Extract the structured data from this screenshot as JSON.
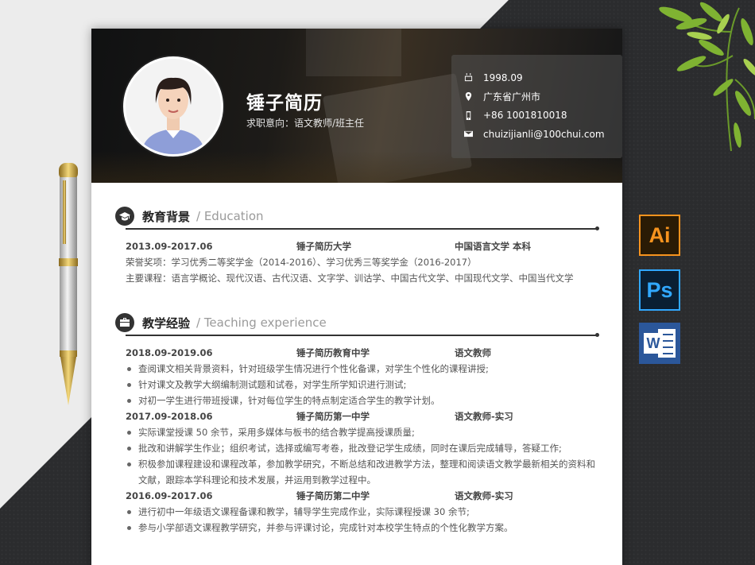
{
  "resume": {
    "name": "锤子简历",
    "objective": "求职意向：语文教师/班主任",
    "contact": {
      "birth": "1998.09",
      "location": "广东省广州市",
      "phone": "+86 1001810018",
      "email": "chuizijianli@100chui.com"
    }
  },
  "education": {
    "title": "教育背景",
    "subtitle": "/ Education",
    "period": "2013.09-2017.06",
    "school": "锤子简历大学",
    "major": "中国语言文学  本科",
    "honors": "荣誉奖项：学习优秀二等奖学金（2014-2016）、学习优秀三等奖学金（2016-2017）",
    "courses": "主要课程：语言学概论、现代汉语、古代汉语、文字学、训诂学、中国古代文学、中国现代文学、中国当代文学"
  },
  "experience": {
    "title": "教学经验",
    "subtitle": "/ Teaching experience",
    "jobs": [
      {
        "period": "2018.09-2019.06",
        "org": "锤子简历教育中学",
        "role": "语文教师",
        "items": [
          "查阅课文相关背景资料，针对班级学生情况进行个性化备课，对学生个性化的课程讲授;",
          "针对课文及教学大纲编制测试题和试卷，对学生所学知识进行测试;",
          "对初一学生进行带班授课，针对每位学生的特点制定适合学生的教学计划。"
        ]
      },
      {
        "period": "2017.09-2018.06",
        "org": "锤子简历第一中学",
        "role": "语文教师-实习",
        "items": [
          "实际课堂授课 50 余节，采用多媒体与板书的结合教学提高授课质量;",
          "批改和讲解学生作业；组织考试，选择或编写考卷，批改登记学生成绩，同时在课后完成辅导，答疑工作;",
          "积极参加课程建设和课程改革，参加教学研究，不断总结和改进教学方法，整理和阅读语文教学最新相关的资料和文献，跟踪本学科理论和技术发展，并运用到教学过程中。"
        ]
      },
      {
        "period": "2016.09-2017.06",
        "org": "锤子简历第二中学",
        "role": "语文教师-实习",
        "items": [
          "进行初中一年级语文课程备课和教学，辅导学生完成作业，实际课程授课 30 余节;",
          "参与小学部语文课程教学研究，并参与评课讨论，完成针对本校学生特点的个性化教学方案。"
        ]
      }
    ]
  },
  "side_icons": {
    "ai": "Ai",
    "ps": "Ps",
    "word": "W"
  },
  "colors": {
    "page_dark": "#2b2c2e",
    "ai_accent": "#f7931e",
    "ps_accent": "#31a8ff",
    "word_accent": "#2b579a"
  }
}
